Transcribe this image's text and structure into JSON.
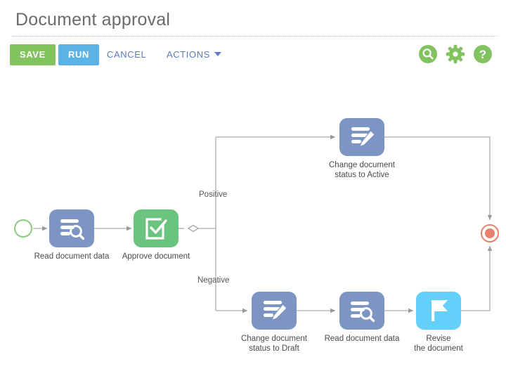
{
  "header": {
    "title": "Document approval"
  },
  "toolbar": {
    "save_label": "SAVE",
    "run_label": "RUN",
    "cancel_label": "CANCEL",
    "actions_label": "ACTIONS",
    "icons": [
      {
        "name": "search-icon",
        "title": "Search"
      },
      {
        "name": "gear-icon",
        "title": "Settings"
      },
      {
        "name": "help-icon",
        "title": "Help"
      }
    ],
    "colors": {
      "save": "#82c25f",
      "run": "#5bb3e8",
      "link": "#5b79c4",
      "icon": "#82c25f"
    }
  },
  "diagram": {
    "start_node": {
      "name": "start-event",
      "color": "#8cc97e"
    },
    "end_node": {
      "name": "end-event",
      "color": "#e8806e"
    },
    "gateway": {
      "name": "exclusive-gateway",
      "color": "#9a9a9a"
    },
    "branch_labels": {
      "positive": "Positive",
      "negative": "Negative"
    },
    "nodes": [
      {
        "id": "read-document-data-1",
        "label": "Read document data",
        "icon": "document-search-icon",
        "color": "#7d95c2"
      },
      {
        "id": "approve-document",
        "label": "Approve document",
        "icon": "check-square-icon",
        "color": "#6ac47f"
      },
      {
        "id": "change-status-active",
        "label": "Change document\nstatus to Active",
        "icon": "document-edit-icon",
        "color": "#7d95c2"
      },
      {
        "id": "change-status-draft",
        "label": "Change document\nstatus to Draft",
        "icon": "document-edit-icon",
        "color": "#7d95c2"
      },
      {
        "id": "read-document-data-2",
        "label": "Read document data",
        "icon": "document-search-icon",
        "color": "#7d95c2"
      },
      {
        "id": "revise-the-document",
        "label": "Revise\nthe document",
        "icon": "flag-icon",
        "color": "#62d0f8"
      }
    ]
  }
}
